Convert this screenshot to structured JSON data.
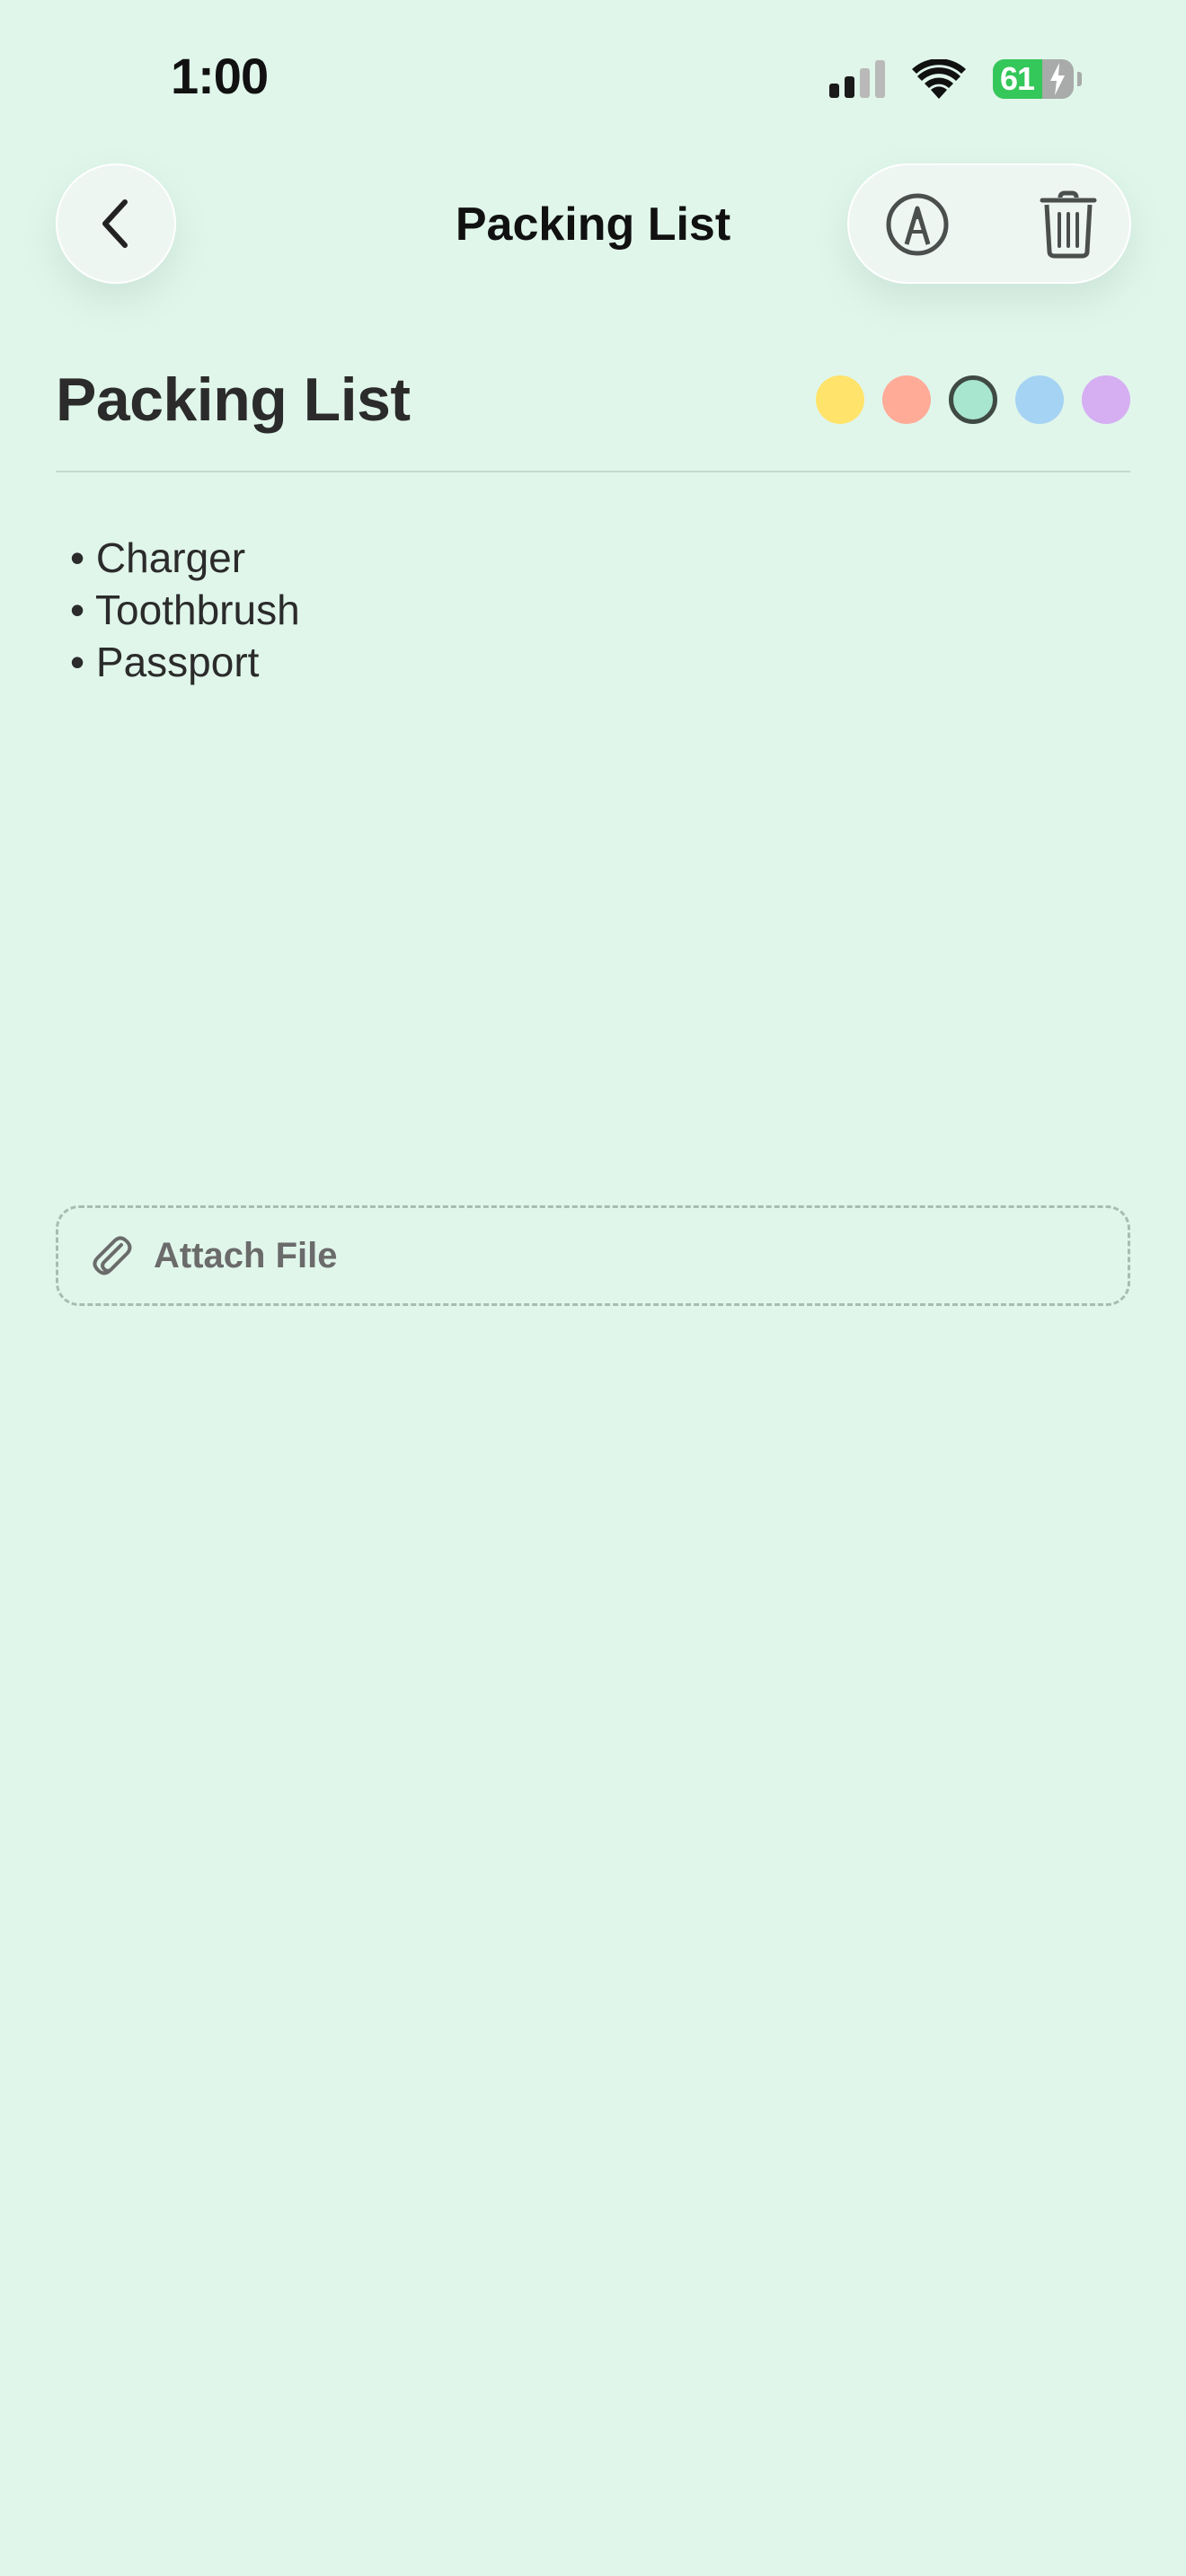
{
  "status_bar": {
    "time": "1:00",
    "battery_level": "61",
    "battery_fraction": 0.61,
    "signal_bars_active": 2,
    "signal_bars_total": 4,
    "icons": [
      "cellular-signal-icon",
      "wifi-icon",
      "battery-charging-icon"
    ]
  },
  "nav": {
    "title": "Packing List",
    "back_icon": "chevron-left-icon",
    "markup_icon": "pen-circle-icon",
    "delete_icon": "trash-icon"
  },
  "note": {
    "title": "Packing List",
    "lines": [
      "• Charger",
      "• Toothbrush",
      "• Passport"
    ]
  },
  "color_options": [
    {
      "name": "yellow",
      "color": "#ffe36b",
      "selected": false
    },
    {
      "name": "coral",
      "color": "#ffab98",
      "selected": false
    },
    {
      "name": "mint",
      "color": "#a8e6cf",
      "selected": true
    },
    {
      "name": "blue",
      "color": "#a5d3f3",
      "selected": false
    },
    {
      "name": "lavender",
      "color": "#d6aef2",
      "selected": false
    }
  ],
  "attach": {
    "label": "Attach File",
    "icon": "paperclip-icon"
  },
  "colors": {
    "background": "#e0f6eb",
    "battery_green": "#34c759"
  }
}
